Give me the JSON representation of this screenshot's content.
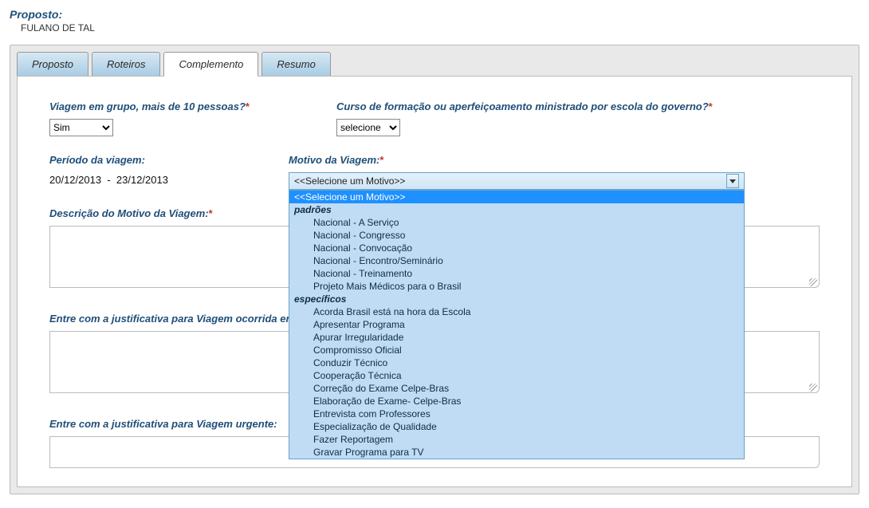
{
  "header": {
    "label": "Proposto:",
    "value": "FULANO DE TAL"
  },
  "tabs": [
    {
      "label": "Proposto",
      "active": false
    },
    {
      "label": "Roteiros",
      "active": false
    },
    {
      "label": "Complemento",
      "active": true
    },
    {
      "label": "Resumo",
      "active": false
    }
  ],
  "fields": {
    "group_trip_label": "Viagem em grupo, mais de 10 pessoas?",
    "group_trip_value": "Sim",
    "course_label": "Curso de formação ou aperfeiçoamento ministrado por escola do governo?",
    "course_value": "selecione",
    "period_label": "Período da viagem:",
    "period_from": "20/12/2013",
    "period_sep": "-",
    "period_to": "23/12/2013",
    "motive_label": "Motivo da Viagem:",
    "motive_display": "<<Selecione um Motivo>>",
    "desc_label": "Descrição do Motivo da Viagem:",
    "just1_label": "Entre com a justificativa para Viagem ocorrida em final de semana, feriado ou iniciada na Segunda-Feira:",
    "just2_label": "Entre com a justificativa para Viagem urgente:"
  },
  "motive_options": {
    "selected": "<<Selecione um Motivo>>",
    "groups": [
      {
        "title": "padrões",
        "items": [
          "Nacional - A Serviço",
          "Nacional - Congresso",
          "Nacional - Convocação",
          "Nacional - Encontro/Seminário",
          "Nacional - Treinamento",
          "Projeto Mais Médicos para o Brasil"
        ]
      },
      {
        "title": "específicos",
        "items": [
          "Acorda Brasil está na hora da Escola",
          "Apresentar Programa",
          "Apurar Irregularidade",
          "Compromisso Oficial",
          "Conduzir Técnico",
          "Cooperação Técnica",
          "Correção do Exame Celpe-Bras",
          "Elaboração de Exame- Celpe-Bras",
          "Entrevista com Professores",
          "Especialização de Qualidade",
          "Fazer Reportagem",
          "Gravar Programa para TV"
        ]
      }
    ]
  }
}
